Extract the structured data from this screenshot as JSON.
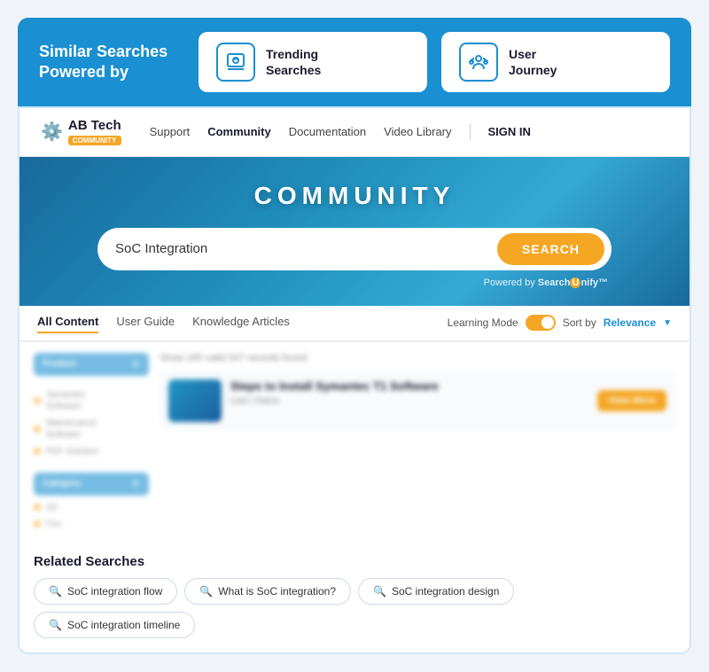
{
  "banner": {
    "title": "Similar Searches\nPowered by",
    "cards": [
      {
        "id": "trending",
        "label": "Trending\nSearches",
        "icon": "🔍"
      },
      {
        "id": "journey",
        "label": "User\nJourney",
        "icon": "👤"
      }
    ]
  },
  "nav": {
    "logo_text": "AB Tech",
    "logo_badge": "COMMUNITY",
    "links": [
      {
        "id": "support",
        "label": "Support",
        "active": false
      },
      {
        "id": "community",
        "label": "Community",
        "active": true
      },
      {
        "id": "documentation",
        "label": "Documentation",
        "active": false
      },
      {
        "id": "video_library",
        "label": "Video Library",
        "active": false
      }
    ],
    "signin": "SIGN IN"
  },
  "hero": {
    "title": "COMMUNITY",
    "search_value": "SoC Integration",
    "search_button": "SEARCH",
    "powered_text": "Powered by",
    "powered_brand": "SearchUnify"
  },
  "tabs": [
    {
      "id": "all_content",
      "label": "All Content",
      "active": true
    },
    {
      "id": "user_guide",
      "label": "User Guide",
      "active": false
    },
    {
      "id": "knowledge_articles",
      "label": "Knowledge Articles",
      "active": false
    }
  ],
  "filters": {
    "learning_mode": "Learning Mode",
    "sort_by_label": "Sort by",
    "sort_by_value": "Relevance"
  },
  "sidebar": {
    "filter1_label": "Product",
    "items1": [
      {
        "label": "Symantec\nSoftware"
      },
      {
        "label": "Maintenance\nSoftware"
      },
      {
        "label": "PDF Solution"
      }
    ],
    "filter2_label": "Category",
    "items2": [
      {
        "label": "Q1"
      },
      {
        "label": "Foo"
      }
    ]
  },
  "results": {
    "count_text": "Show 245 valid 547 records found",
    "card": {
      "title": "Steps to Install Symantec T1 Software",
      "meta": "Last | Status",
      "action": "View More"
    }
  },
  "related_searches": {
    "title": "Related Searches",
    "chips": [
      {
        "id": "flow",
        "label": "SoC integration flow"
      },
      {
        "id": "what_is",
        "label": "What is SoC integration?"
      },
      {
        "id": "design",
        "label": "SoC integration design"
      },
      {
        "id": "timeline",
        "label": "SoC integration timeline"
      }
    ],
    "search_icon": "🔍"
  }
}
